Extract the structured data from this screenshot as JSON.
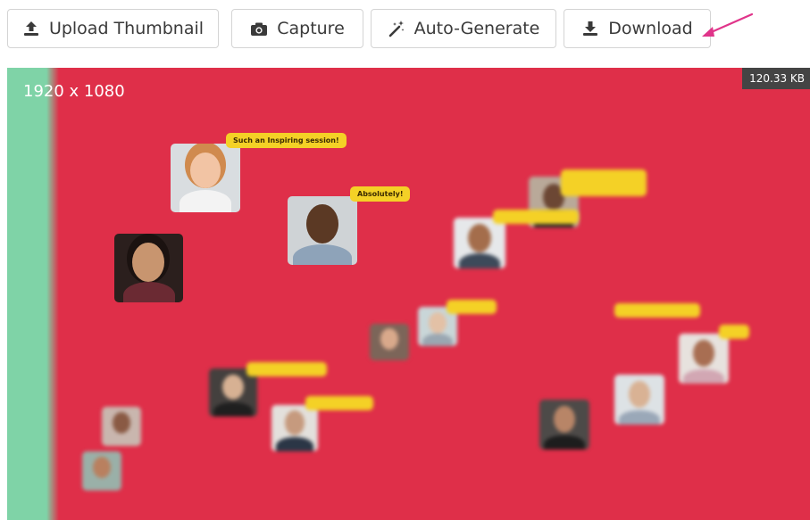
{
  "toolbar": {
    "upload_label": "Upload Thumbnail",
    "capture_label": "Capture",
    "autogen_label": "Auto-Generate",
    "download_label": "Download"
  },
  "preview": {
    "resolution": "1920 x 1080",
    "file_size": "120.33 KB",
    "background_color": "#df2f49",
    "side_bar_color": "#7fd3a7",
    "bubble_color": "#f4d126",
    "bubbles": {
      "b1": "Such an Inspiring session!",
      "b2": "Absolutely!"
    }
  },
  "annotation": {
    "arrow_color": "#e0348a"
  }
}
